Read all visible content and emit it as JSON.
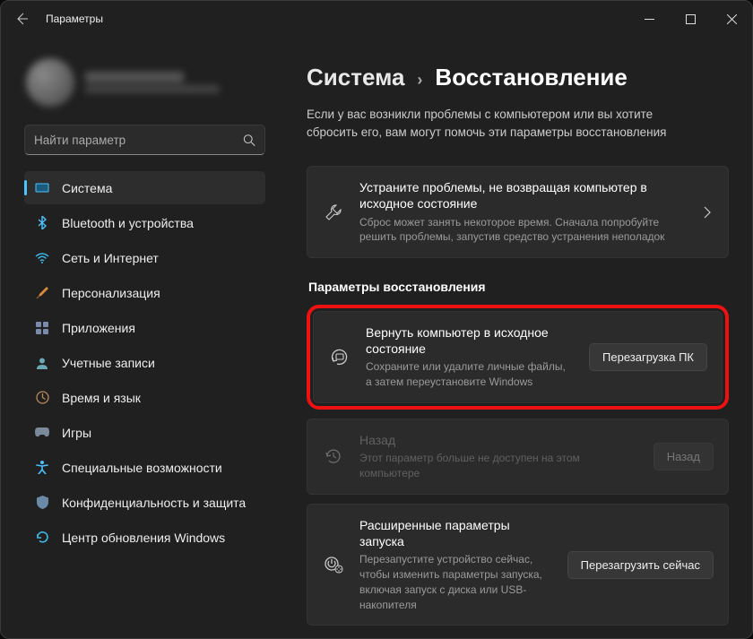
{
  "window": {
    "title": "Параметры"
  },
  "search": {
    "placeholder": "Найти параметр"
  },
  "nav": {
    "items": [
      {
        "label": "Система"
      },
      {
        "label": "Bluetooth и устройства"
      },
      {
        "label": "Сеть и Интернет"
      },
      {
        "label": "Персонализация"
      },
      {
        "label": "Приложения"
      },
      {
        "label": "Учетные записи"
      },
      {
        "label": "Время и язык"
      },
      {
        "label": "Игры"
      },
      {
        "label": "Специальные возможности"
      },
      {
        "label": "Конфиденциальность и защита"
      },
      {
        "label": "Центр обновления Windows"
      }
    ]
  },
  "breadcrumb": {
    "parent": "Система",
    "sep": "›",
    "current": "Восстановление"
  },
  "page_subtitle": "Если у вас возникли проблемы с компьютером или вы хотите сбросить его, вам могут помочь эти параметры восстановления",
  "fix_card": {
    "title": "Устраните проблемы, не возвращая компьютер в исходное состояние",
    "desc": "Сброс может занять некоторое время. Сначала попробуйте решить проблемы, запустив средство устранения неполадок"
  },
  "section_heading": "Параметры восстановления",
  "reset_card": {
    "title": "Вернуть компьютер в исходное состояние",
    "desc": "Сохраните или удалите личные файлы, а затем переустановите Windows",
    "button": "Перезагрузка ПК"
  },
  "goback_card": {
    "title": "Назад",
    "desc": "Этот параметр больше не доступен на этом компьютере",
    "button": "Назад"
  },
  "advanced_card": {
    "title": "Расширенные параметры запуска",
    "desc": "Перезапустите устройство сейчас, чтобы изменить параметры запуска, включая запуск с диска или USB-накопителя",
    "button": "Перезагрузить сейчас"
  }
}
